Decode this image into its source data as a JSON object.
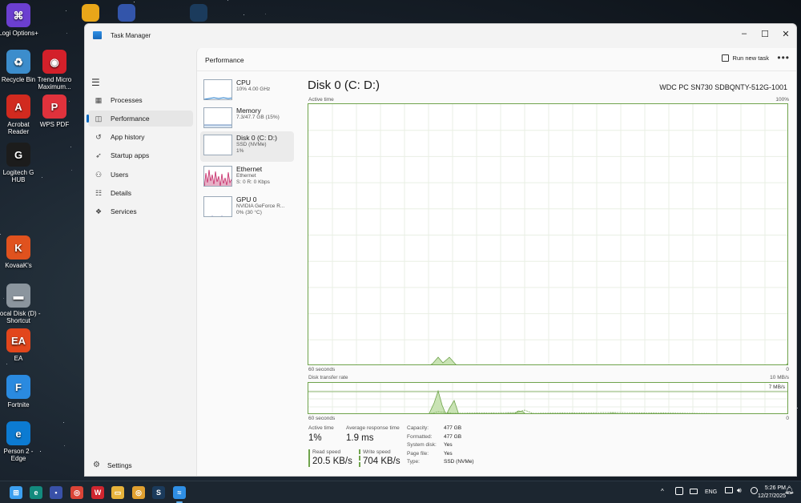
{
  "desktop": {
    "icons": [
      {
        "label": "Logi Options+",
        "glyph": "⌘",
        "color": "#6b3fd0"
      },
      {
        "label": "Recycle Bin",
        "glyph": "♻",
        "color": "#3c8dcc"
      },
      {
        "label": "Acrobat Reader",
        "glyph": "A",
        "color": "#d12a1f"
      },
      {
        "label": "Logitech G HUB",
        "glyph": "G",
        "color": "#1c1c1c"
      },
      {
        "label": "KovaaK's",
        "glyph": "K",
        "color": "#e0521e"
      },
      {
        "label": "Local Disk (D) - Shortcut",
        "glyph": "▬",
        "color": "#8b959e"
      },
      {
        "label": "EA",
        "glyph": "EA",
        "color": "#e2461c"
      },
      {
        "label": "Fortnite",
        "glyph": "F",
        "color": "#2a8ae0"
      },
      {
        "label": "Person 2 - Edge",
        "glyph": "e",
        "color": "#0c7bd2"
      },
      {
        "label": "Trend Micro Maximum...",
        "glyph": "◉",
        "color": "#d3202a"
      },
      {
        "label": "WPS PDF",
        "glyph": "P",
        "color": "#e0323c"
      }
    ]
  },
  "window": {
    "title": "Task Manager",
    "controls": {
      "minimize": "–",
      "maximize": "☐",
      "close": "✕"
    }
  },
  "nav": {
    "menu_icon": "☰",
    "items": [
      {
        "label": "Processes",
        "icon": "▦"
      },
      {
        "label": "Performance",
        "icon": "◫"
      },
      {
        "label": "App history",
        "icon": "↺"
      },
      {
        "label": "Startup apps",
        "icon": "➶"
      },
      {
        "label": "Users",
        "icon": "⚇"
      },
      {
        "label": "Details",
        "icon": "☷"
      },
      {
        "label": "Services",
        "icon": "❖"
      }
    ],
    "settings": {
      "label": "Settings",
      "icon": "⚙"
    }
  },
  "header": {
    "title": "Performance",
    "run_new_task": "Run new task",
    "more": "•••"
  },
  "perf_list": [
    {
      "name": "CPU",
      "sub1": "10% 4.00 GHz",
      "sub2": "",
      "sub3": ""
    },
    {
      "name": "Memory",
      "sub1": "7.3/47.7 GB (15%)",
      "sub2": "",
      "sub3": ""
    },
    {
      "name": "Disk 0 (C: D:)",
      "sub1": "SSD (NVMe)",
      "sub2": "1%",
      "sub3": ""
    },
    {
      "name": "Ethernet",
      "sub1": "Ethernet",
      "sub2": "S: 0 R: 0 Kbps",
      "sub3": ""
    },
    {
      "name": "GPU 0",
      "sub1": "NVIDIA GeForce R...",
      "sub2": "0% (30 °C)",
      "sub3": ""
    }
  ],
  "disk": {
    "title": "Disk 0 (C: D:)",
    "model": "WDC PC SN730 SDBQNTY-512G-1001",
    "active_time_graph": {
      "label": "Active time",
      "max_label": "100%",
      "x_left": "60 seconds",
      "x_right": "0"
    },
    "transfer_graph": {
      "label": "Disk transfer rate",
      "max_label": "10 MB/s",
      "ref_label": "7 MB/s",
      "x_left": "60 seconds",
      "x_right": "0"
    },
    "stats": {
      "active_time": {
        "label": "Active time",
        "value": "1%"
      },
      "avg_response": {
        "label": "Average response time",
        "value": "1.9 ms"
      },
      "read_speed": {
        "label": "Read speed",
        "value": "20.5 KB/s"
      },
      "write_speed": {
        "label": "Write speed",
        "value": "704 KB/s"
      }
    },
    "properties": [
      {
        "key": "Capacity:",
        "value": "477 GB"
      },
      {
        "key": "Formatted:",
        "value": "477 GB"
      },
      {
        "key": "System disk:",
        "value": "Yes"
      },
      {
        "key": "Page file:",
        "value": "Yes"
      },
      {
        "key": "Type:",
        "value": "SSD (NVMe)"
      }
    ]
  },
  "colors": {
    "disk_green": "#6fa34c",
    "disk_fill": "#c9e3b4",
    "accent": "#0067c0",
    "net_pink": "#c2185b"
  },
  "taskbar": {
    "apps": [
      {
        "name": "Start",
        "glyph": "⊞",
        "color": "#3ca0f0"
      },
      {
        "name": "Edge",
        "glyph": "e",
        "color": "#138a7e"
      },
      {
        "name": "Save",
        "glyph": "▪",
        "color": "#3951a8"
      },
      {
        "name": "Chrome",
        "glyph": "◎",
        "color": "#db4437"
      },
      {
        "name": "WPS",
        "glyph": "W",
        "color": "#d0262f"
      },
      {
        "name": "Explorer",
        "glyph": "▭",
        "color": "#e7b33b"
      },
      {
        "name": "Chrome 2",
        "glyph": "◎",
        "color": "#e0a030"
      },
      {
        "name": "Steam",
        "glyph": "S",
        "color": "#1b3b5c"
      },
      {
        "name": "Task Manager",
        "glyph": "≈",
        "color": "#2f8fe5"
      }
    ],
    "tray": {
      "chevron": "^",
      "lang": "ENG"
    },
    "clock": {
      "time": "5:26 PM",
      "date": "12/27/2025"
    }
  }
}
